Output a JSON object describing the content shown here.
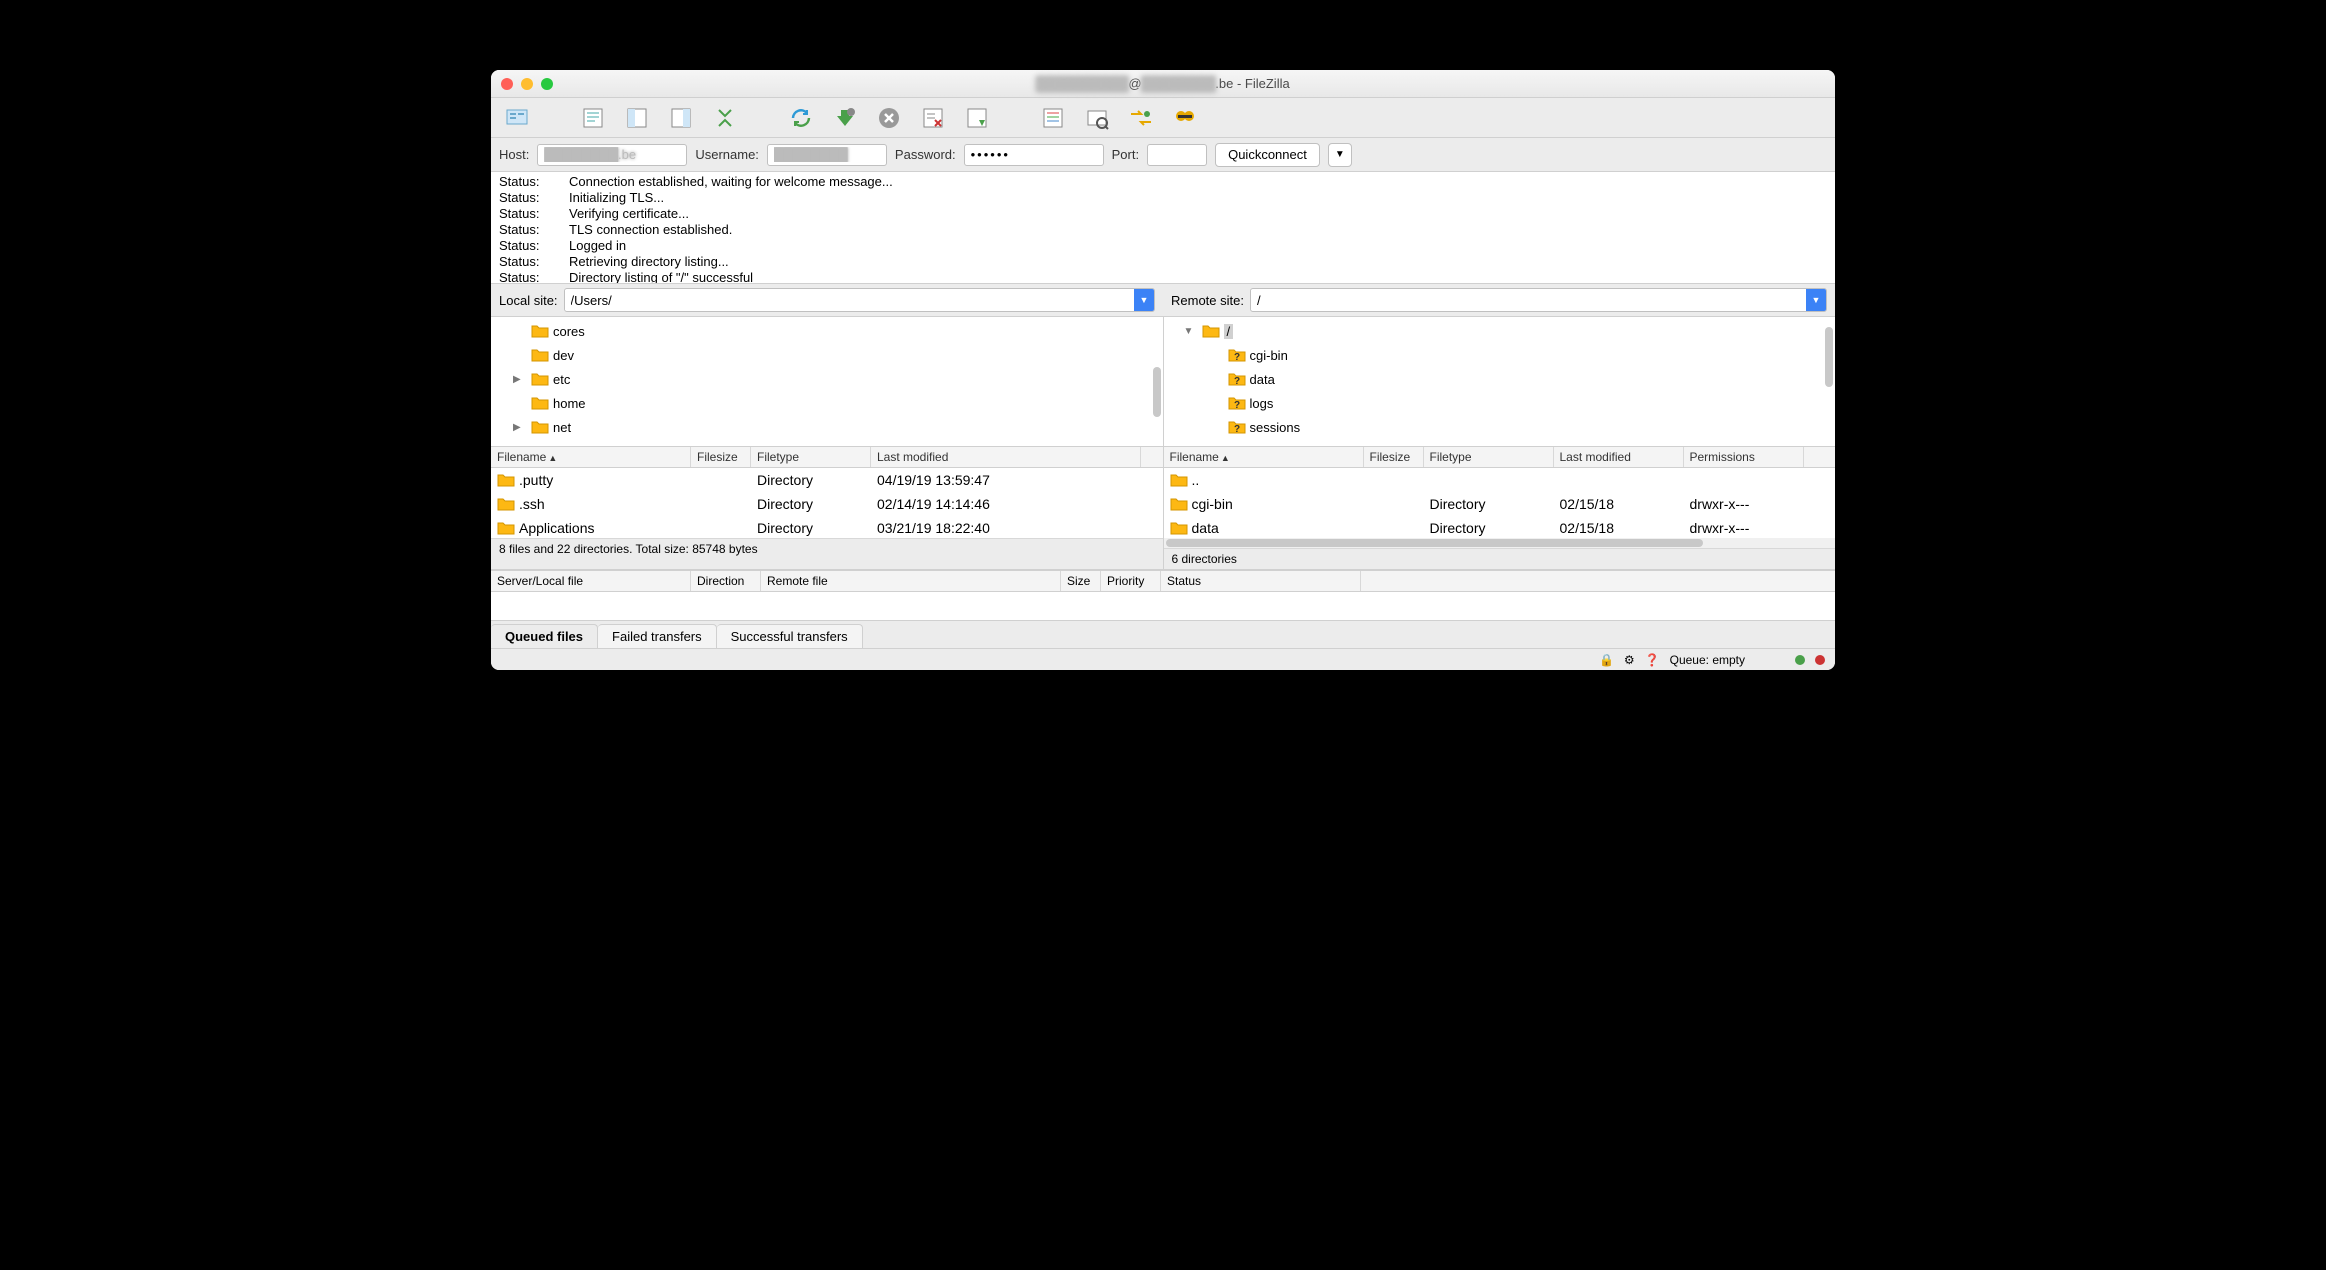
{
  "title": {
    "prefix_blur": "██████████",
    "mid": "@",
    "suffix_blur": "████████",
    "domain": ".be",
    "app": " - FileZilla"
  },
  "quick": {
    "host_label": "Host:",
    "host_value": "████████.be",
    "user_label": "Username:",
    "user_value": "████████",
    "pass_label": "Password:",
    "pass_value": "••••••",
    "port_label": "Port:",
    "port_value": "",
    "connect": "Quickconnect"
  },
  "log_label": "Status:",
  "log": [
    "Connection established, waiting for welcome message...",
    "Initializing TLS...",
    "Verifying certificate...",
    "TLS connection established.",
    "Logged in",
    "Retrieving directory listing...",
    "Directory listing of \"/\" successful"
  ],
  "local": {
    "label": "Local site:",
    "path": "/Users/",
    "tree": [
      {
        "name": "cores",
        "disclosure": ""
      },
      {
        "name": "dev",
        "disclosure": ""
      },
      {
        "name": "etc",
        "disclosure": "▶"
      },
      {
        "name": "home",
        "disclosure": ""
      },
      {
        "name": "net",
        "disclosure": "▶"
      }
    ],
    "cols": [
      "Filename",
      "Filesize",
      "Filetype",
      "Last modified"
    ],
    "widths": [
      200,
      60,
      120,
      270
    ],
    "rows": [
      {
        "name": ".putty",
        "size": "",
        "type": "Directory",
        "mod": "04/19/19 13:59:47"
      },
      {
        "name": ".ssh",
        "size": "",
        "type": "Directory",
        "mod": "02/14/19 14:14:46"
      },
      {
        "name": "Applications",
        "size": "",
        "type": "Directory",
        "mod": "03/21/19 18:22:40"
      }
    ],
    "status": "8 files and 22 directories. Total size: 85748 bytes"
  },
  "remote": {
    "label": "Remote site:",
    "path": "/",
    "root": "/",
    "tree": [
      {
        "name": "cgi-bin"
      },
      {
        "name": "data"
      },
      {
        "name": "logs"
      },
      {
        "name": "sessions"
      }
    ],
    "cols": [
      "Filename",
      "Filesize",
      "Filetype",
      "Last modified",
      "Permissions"
    ],
    "widths": [
      200,
      60,
      130,
      130,
      120
    ],
    "rows": [
      {
        "name": "..",
        "size": "",
        "type": "",
        "mod": "",
        "perm": ""
      },
      {
        "name": "cgi-bin",
        "size": "",
        "type": "Directory",
        "mod": "02/15/18",
        "perm": "drwxr-x---"
      },
      {
        "name": "data",
        "size": "",
        "type": "Directory",
        "mod": "02/15/18",
        "perm": "drwxr-x---"
      }
    ],
    "status": "6 directories"
  },
  "queue": {
    "cols": [
      "Server/Local file",
      "Direction",
      "Remote file",
      "Size",
      "Priority",
      "Status"
    ],
    "widths": [
      200,
      70,
      300,
      40,
      60,
      200
    ]
  },
  "tabs": {
    "queued": "Queued files",
    "failed": "Failed transfers",
    "success": "Successful transfers"
  },
  "statusbar": {
    "queue": "Queue: empty"
  }
}
